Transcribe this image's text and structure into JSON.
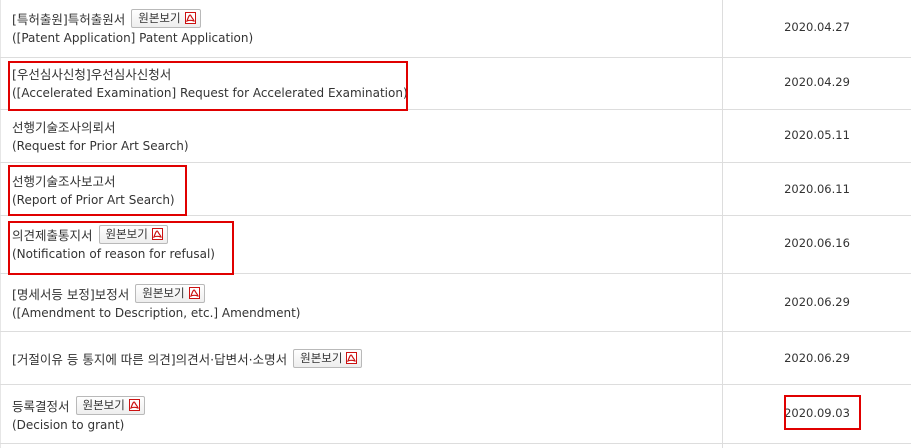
{
  "view_button_label": "원본보기",
  "rows": [
    {
      "ko": "[특허출원]특허출원서",
      "en": "([Patent Application] Patent Application)",
      "has_button": true,
      "date": "2020.04.27"
    },
    {
      "ko": "[우선심사신청]우선심사신청서",
      "en": "([Accelerated Examination] Request for Accelerated Examination)",
      "has_button": false,
      "date": "2020.04.29"
    },
    {
      "ko": "선행기술조사의뢰서",
      "en": "(Request for Prior Art Search)",
      "has_button": false,
      "date": "2020.05.11"
    },
    {
      "ko": "선행기술조사보고서",
      "en": "(Report of Prior Art Search)",
      "has_button": false,
      "date": "2020.06.11"
    },
    {
      "ko": "의견제출통지서",
      "en": "(Notification of reason for refusal)",
      "has_button": true,
      "date": "2020.06.16"
    },
    {
      "ko": "[명세서등 보정]보정서",
      "en": "([Amendment to Description, etc.] Amendment)",
      "has_button": true,
      "date": "2020.06.29"
    },
    {
      "ko": "[거절이유 등 통지에 따른 의견]의견서·답변서·소명서",
      "en": "",
      "has_button": true,
      "date": "2020.06.29"
    },
    {
      "ko": "등록결정서",
      "en": "(Decision to grant)",
      "has_button": true,
      "date": "2020.09.03"
    }
  ],
  "colors": {
    "highlight": "#e00000",
    "pdf_icon": "#cc1111",
    "border": "#dddddd"
  },
  "icons": {
    "view_button": "pdf-icon"
  }
}
